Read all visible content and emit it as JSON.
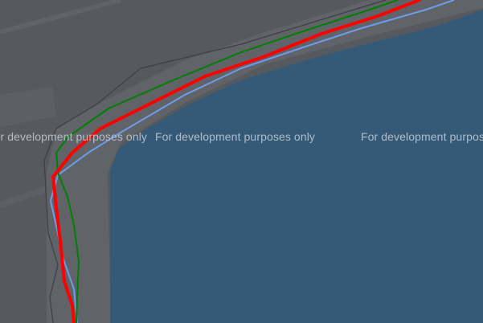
{
  "map": {
    "watermark_text": "For development purposes only",
    "colors": {
      "land": "#56595e",
      "water": "#355a78",
      "road": "#606368",
      "road_dark": "#4e5156",
      "track_red": "#ff0000",
      "track_green": "#008000",
      "track_blue": "#6f9be8",
      "track_dark": "#3c3f44"
    },
    "tracks": [
      {
        "name": "red",
        "color": "#ff0000"
      },
      {
        "name": "green",
        "color": "#008000"
      },
      {
        "name": "blue",
        "color": "#6f9be8"
      },
      {
        "name": "dark",
        "color": "#3c3f44"
      }
    ]
  }
}
